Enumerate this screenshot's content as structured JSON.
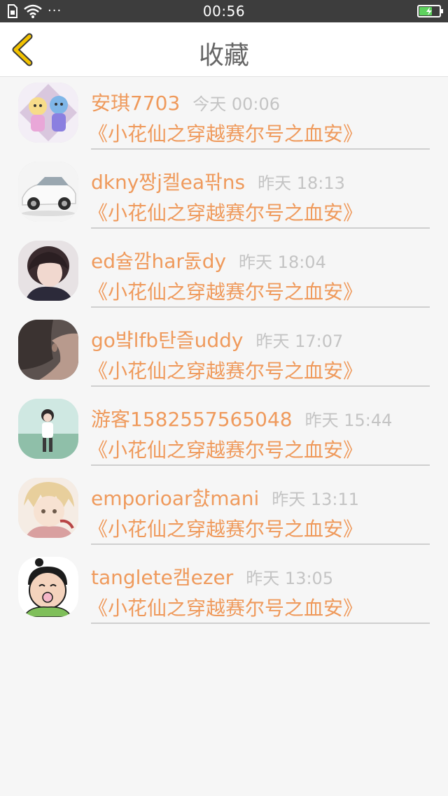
{
  "status_bar": {
    "time": "00:56",
    "more": "···",
    "battery_level": 0.65
  },
  "header": {
    "title": "收藏"
  },
  "items": [
    {
      "name": "安琪7703",
      "time": "今天 00:06",
      "book": "《小花仙之穿越赛尔号之血安》"
    },
    {
      "name": "dkny짱j켈ea팎ns",
      "time": "昨天 18:13",
      "book": "《小花仙之穿越赛尔号之血安》"
    },
    {
      "name": "ed슐깜har돐dy",
      "time": "昨天 18:04",
      "book": "《小花仙之穿越赛尔号之血安》"
    },
    {
      "name": "go뱤lfb탄즐uddy",
      "time": "昨天 17:07",
      "book": "《小花仙之穿越赛尔号之血安》"
    },
    {
      "name": "游客1582557565048",
      "time": "昨天 15:44",
      "book": "《小花仙之穿越赛尔号之血安》"
    },
    {
      "name": "emporioar챬mani",
      "time": "昨天 13:11",
      "book": "《小花仙之穿越赛尔号之血安》"
    },
    {
      "name": "tanglete캠ezer",
      "time": "昨天 13:05",
      "book": "《小花仙之穿越赛尔号之血安》"
    }
  ]
}
